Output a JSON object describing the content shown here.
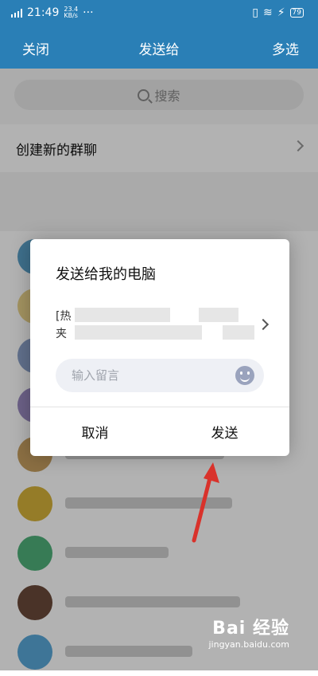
{
  "status_bar": {
    "time": "21:49",
    "net_speed_value": "23.4",
    "net_speed_unit": "KB/s",
    "dots": "···",
    "battery": "79"
  },
  "nav": {
    "close": "关闭",
    "title": "发送给",
    "multi_select": "多选"
  },
  "search": {
    "placeholder": "搜索"
  },
  "create_group": {
    "label": "创建新的群聊"
  },
  "dialog": {
    "title": "发送给我的电脑",
    "preview_line1": "[热",
    "preview_line2": "夹",
    "message_placeholder": "输入留言",
    "cancel": "取消",
    "send": "发送"
  },
  "watermark": {
    "logo": "Bai 经验",
    "url": "jingyan.baidu.com"
  },
  "colors": {
    "header_blue": "#2a7fb6",
    "arrow_red": "#d9322b",
    "emoji_icon": "#9aa3bd"
  },
  "icons": {
    "search": "search-icon",
    "chevron": "chevron-right-icon",
    "emoji": "emoji-icon",
    "battery": "battery-icon",
    "signal": "signal-icon"
  }
}
